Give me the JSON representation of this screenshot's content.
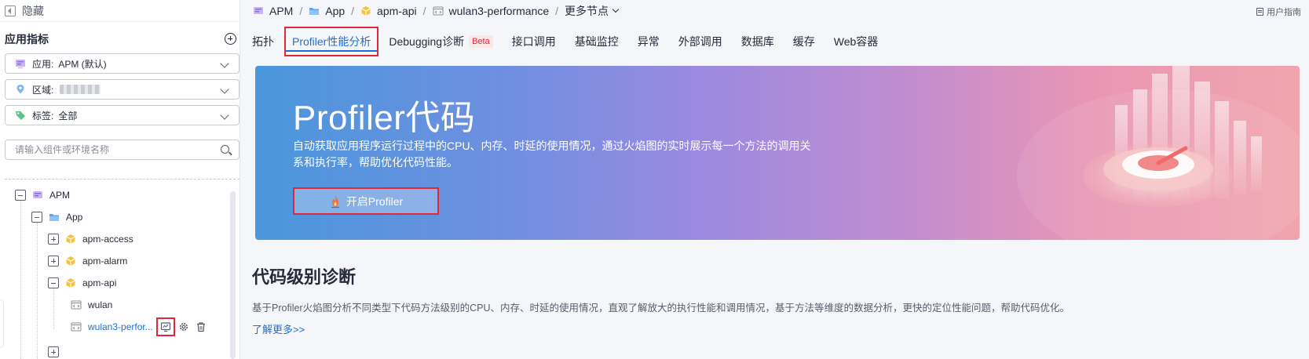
{
  "sidebar": {
    "hide_label": "隐藏",
    "metrics_title": "应用指标",
    "app_select": {
      "label": "应用:",
      "value": "APM (默认)"
    },
    "region_select": {
      "label": "区域:"
    },
    "tag_select": {
      "label": "标签:",
      "value": "全部"
    },
    "search": {
      "placeholder": "请输入组件或环境名称"
    },
    "tree": [
      {
        "label": "APM"
      },
      {
        "label": "App"
      },
      {
        "label": "apm-access"
      },
      {
        "label": "apm-alarm"
      },
      {
        "label": "apm-api"
      },
      {
        "label": "wulan"
      },
      {
        "label": "wulan3-perfor..."
      }
    ]
  },
  "breadcrumb": {
    "items": [
      "APM",
      "App",
      "apm-api",
      "wulan3-performance"
    ],
    "more": "更多节点",
    "separator": "/"
  },
  "header": {
    "user_guide": "用户指南"
  },
  "tabs": [
    {
      "label": "拓扑"
    },
    {
      "label": "Profiler性能分析"
    },
    {
      "label": "Debugging诊断",
      "badge": "Beta"
    },
    {
      "label": "接口调用"
    },
    {
      "label": "基础监控"
    },
    {
      "label": "异常"
    },
    {
      "label": "外部调用"
    },
    {
      "label": "数据库"
    },
    {
      "label": "缓存"
    },
    {
      "label": "Web容器"
    }
  ],
  "banner": {
    "title": "Profiler代码",
    "desc": "自动获取应用程序运行过程中的CPU、内存、时延的使用情况，通过火焰图的实时展示每一个方法的调用关系和执行率，帮助优化代码性能。",
    "button": "开启Profiler"
  },
  "section": {
    "title": "代码级别诊断",
    "desc": "基于Profiler火焰图分析不同类型下代码方法级别的CPU、内存、时延的使用情况，直观了解放大的执行性能和调用情况，基于方法等维度的数据分析，更快的定位性能问题，帮助代码优化。",
    "learn_more": "了解更多>>"
  },
  "colors": {
    "accent": "#1e6fd9",
    "highlight": "#e0283b",
    "banner_start": "#4a97dc",
    "banner_end": "#f0a5ad"
  },
  "icons": [
    "hide-icon",
    "add-icon",
    "app-icon",
    "location-icon",
    "tag-icon",
    "search-icon",
    "folder-icon",
    "cube-icon",
    "code-icon",
    "monitor-icon",
    "gear-icon",
    "trash-icon",
    "doc-icon",
    "flame-icon"
  ]
}
